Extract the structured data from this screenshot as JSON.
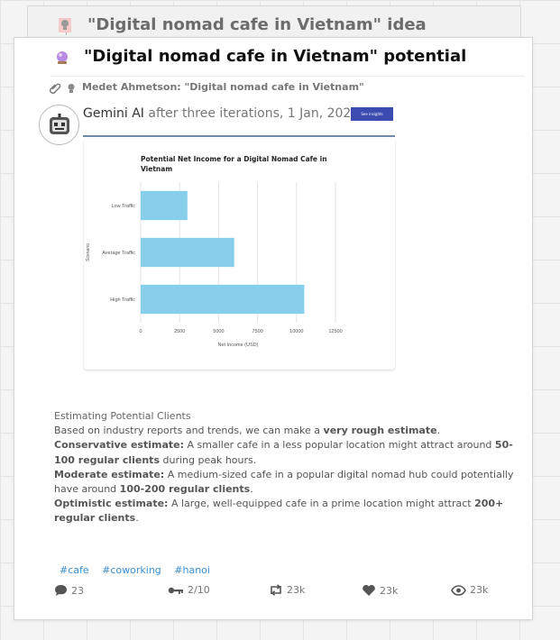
{
  "back_card": {
    "title": "\"Digital nomad cafe in Vietnam\" idea",
    "icon": "lightbulb-icon"
  },
  "card": {
    "title": "\"Digital nomad cafe in Vietnam\" potential",
    "title_icon": "crystal-ball-icon",
    "attachment": {
      "icons": [
        "paperclip-icon",
        "lightbulb-icon"
      ],
      "text": "Medet Ahmetson: \"Digital nomad cafe in Vietnam\""
    },
    "author": {
      "name": "Gemini AI",
      "meta": "after three iterations, 1 Jan, 2020",
      "avatar_icon": "robot-icon",
      "badge": "See insights"
    },
    "body": {
      "heading": "Estimating Potential Clients",
      "intro_prefix": "Based on industry reports and trends, we can make a ",
      "intro_bold": "very rough estimate",
      "intro_suffix": ".",
      "conservative_label": "Conservative estimate:",
      "conservative_text": " A smaller cafe in a less popular location might attract around ",
      "conservative_bold": "50-100 regular clients",
      "conservative_suffix": " during peak hours.",
      "moderate_label": "Moderate estimate:",
      "moderate_text": " A medium-sized cafe in a popular digital nomad hub could potentially have around ",
      "moderate_bold": "100-200 regular clients",
      "moderate_suffix": ".",
      "optimistic_label": "Optimistic estimate:",
      "optimistic_text": " A large, well-equipped cafe in a prime location might attract ",
      "optimistic_bold": "200+ regular clients",
      "optimistic_suffix": "."
    },
    "tags": [
      "#cafe",
      "#coworking",
      "#hanoi"
    ],
    "stats": {
      "comments": "23",
      "iterations": "2/10",
      "reposts": "23k",
      "likes": "23k",
      "views": "23k"
    }
  },
  "colors": {
    "bar": "#87ceeb",
    "accent": "#3b4bb0",
    "tag": "#3a8fd6"
  },
  "chart_data": {
    "type": "bar",
    "orientation": "horizontal",
    "title": "Potential Net Income for a Digital Nomad Cafe in Vietnam",
    "xlabel": "Net Income (USD)",
    "ylabel": "Scenario",
    "categories": [
      "Low Traffic",
      "Average Traffic",
      "High Traffic"
    ],
    "values": [
      3000,
      6000,
      10500
    ],
    "xlim": [
      0,
      12500
    ],
    "xticks": [
      0,
      2500,
      5000,
      7500,
      10000,
      12500
    ],
    "grid": true,
    "legend": "none"
  }
}
